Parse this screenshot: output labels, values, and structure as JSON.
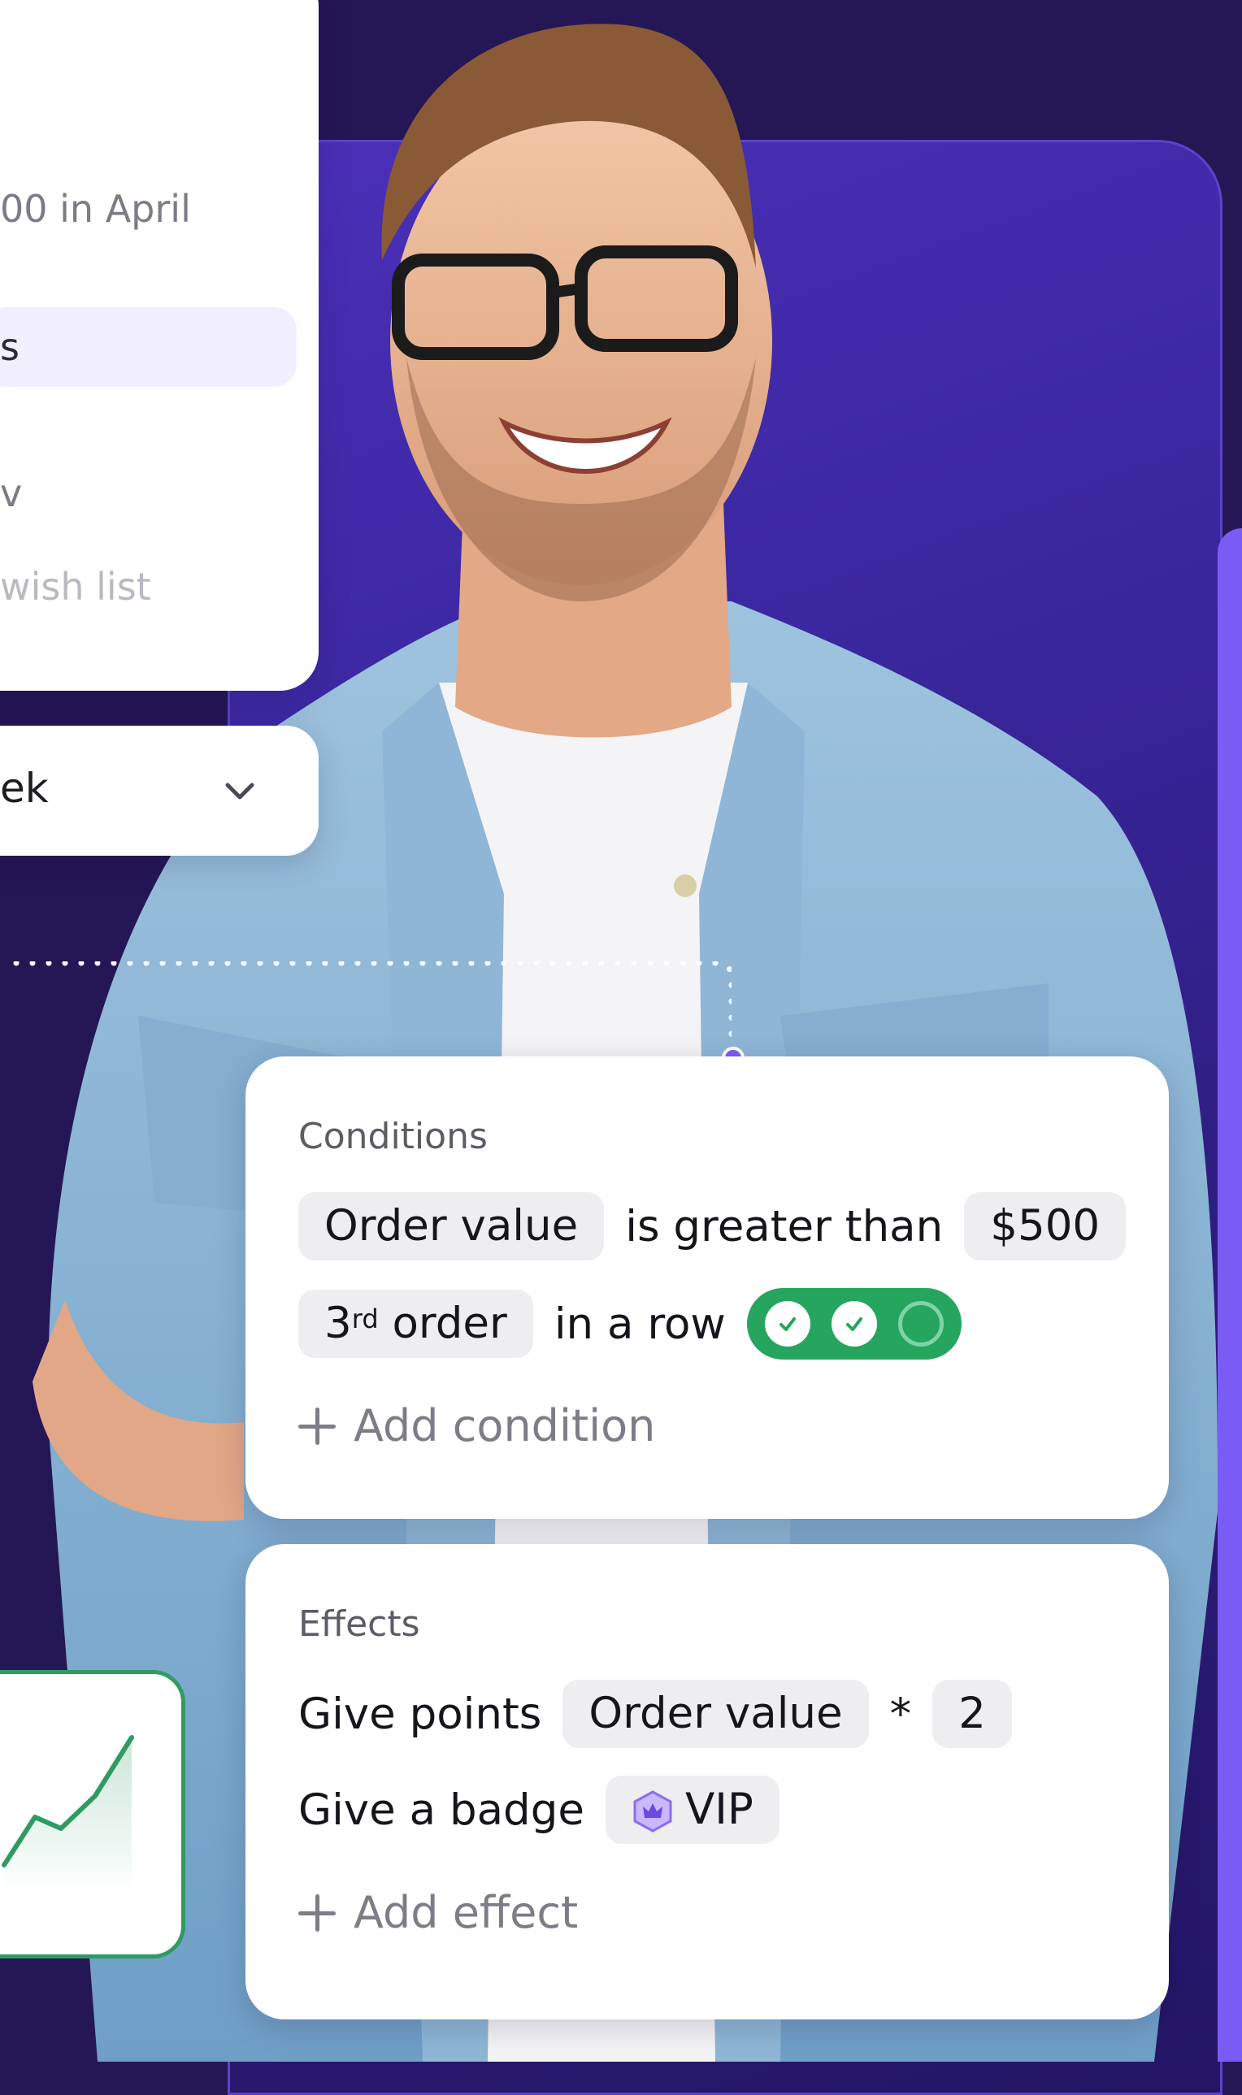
{
  "menu": {
    "items": [
      {
        "label": "00 in April",
        "state": "normal"
      },
      {
        "label": "s",
        "state": "selected"
      },
      {
        "label": "v",
        "state": "normal"
      },
      {
        "label": "wish list",
        "state": "faded"
      }
    ]
  },
  "period_select": {
    "value": "ek",
    "icon": "chevron-down-icon"
  },
  "conditions": {
    "title": "Conditions",
    "row1": {
      "field": "Order value",
      "operator": "is greater than",
      "value": "$500"
    },
    "row2": {
      "ordinal": "3",
      "ordinal_suffix": "rd",
      "ordinal_tail": "order",
      "text": "in a row",
      "streak": [
        "done",
        "done",
        "pending"
      ]
    },
    "add_label": "Add condition"
  },
  "effects": {
    "title": "Effects",
    "row1": {
      "label": "Give points",
      "field": "Order value",
      "operator": "*",
      "value": "2"
    },
    "row2": {
      "label": "Give a badge",
      "badge": "VIP"
    },
    "add_label": "Add effect"
  },
  "colors": {
    "accent": "#7a5cf5",
    "streak_green": "#26a55f",
    "chart_green": "#2f9b63",
    "background": "#251655"
  }
}
